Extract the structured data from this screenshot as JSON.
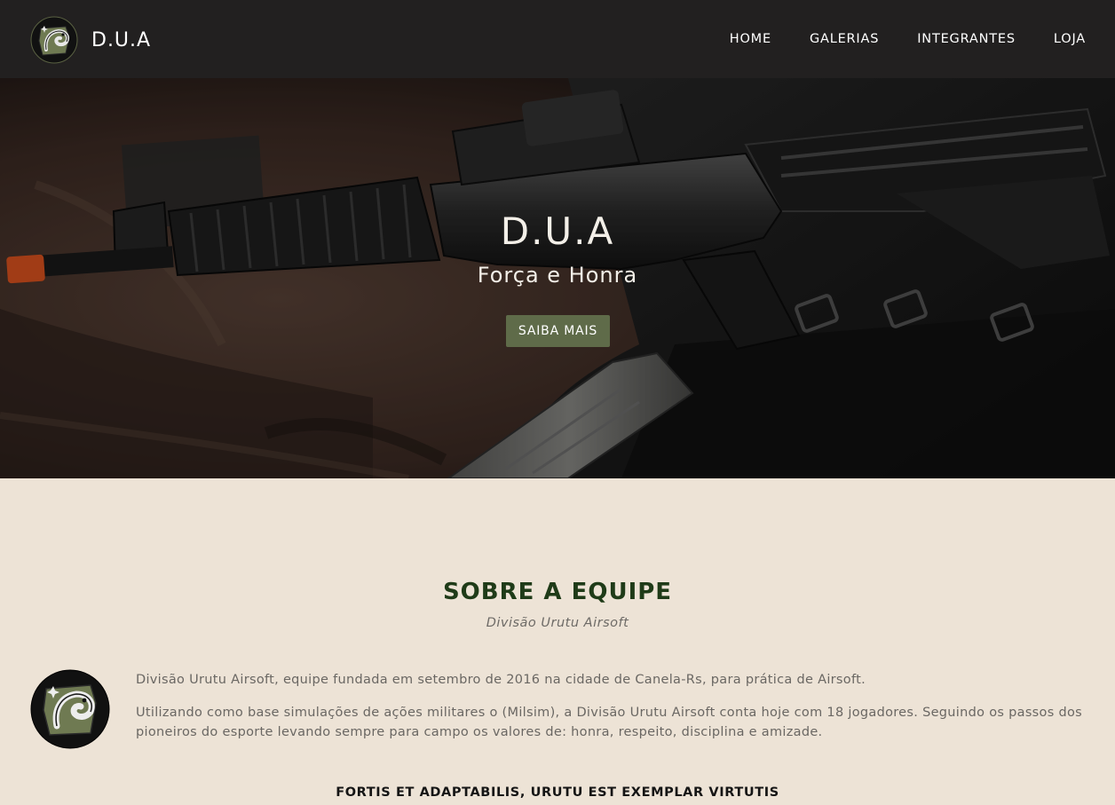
{
  "nav": {
    "brand": "D.U.A",
    "links": [
      "HOME",
      "GALERIAS",
      "INTEGRANTES",
      "LOJA"
    ]
  },
  "hero": {
    "title": "D.U.A",
    "subtitle": "Força e Honra",
    "button_label": "SAIBA MAIS",
    "button_color": "#5f6b49",
    "image_semantic": "airsoft-rifle-on-jacket-image"
  },
  "about": {
    "title": "SOBRE A EQUIPE",
    "subtitle": "Divisão Urutu Airsoft",
    "paragraphs": [
      "Divisão Urutu Airsoft, equipe fundada em setembro de 2016 na cidade de Canela-Rs, para prática de Airsoft.",
      "Utilizando como base simulações de ações militares o (Milsim), a Divisão Urutu Airsoft conta hoje com 18 jogadores. Seguindo os passos dos pioneiros do esporte levando sempre para campo os valores de: honra, respeito, disciplina e amizade."
    ],
    "motto": "FORTIS ET ADAPTABILIS, URUTU EST EXEMPLAR VIRTUTIS",
    "logo_text": "Divisão Urutu",
    "title_color": "#1f3b18"
  },
  "colors": {
    "navbar": "#222020",
    "page_background": "#ede3d6"
  }
}
